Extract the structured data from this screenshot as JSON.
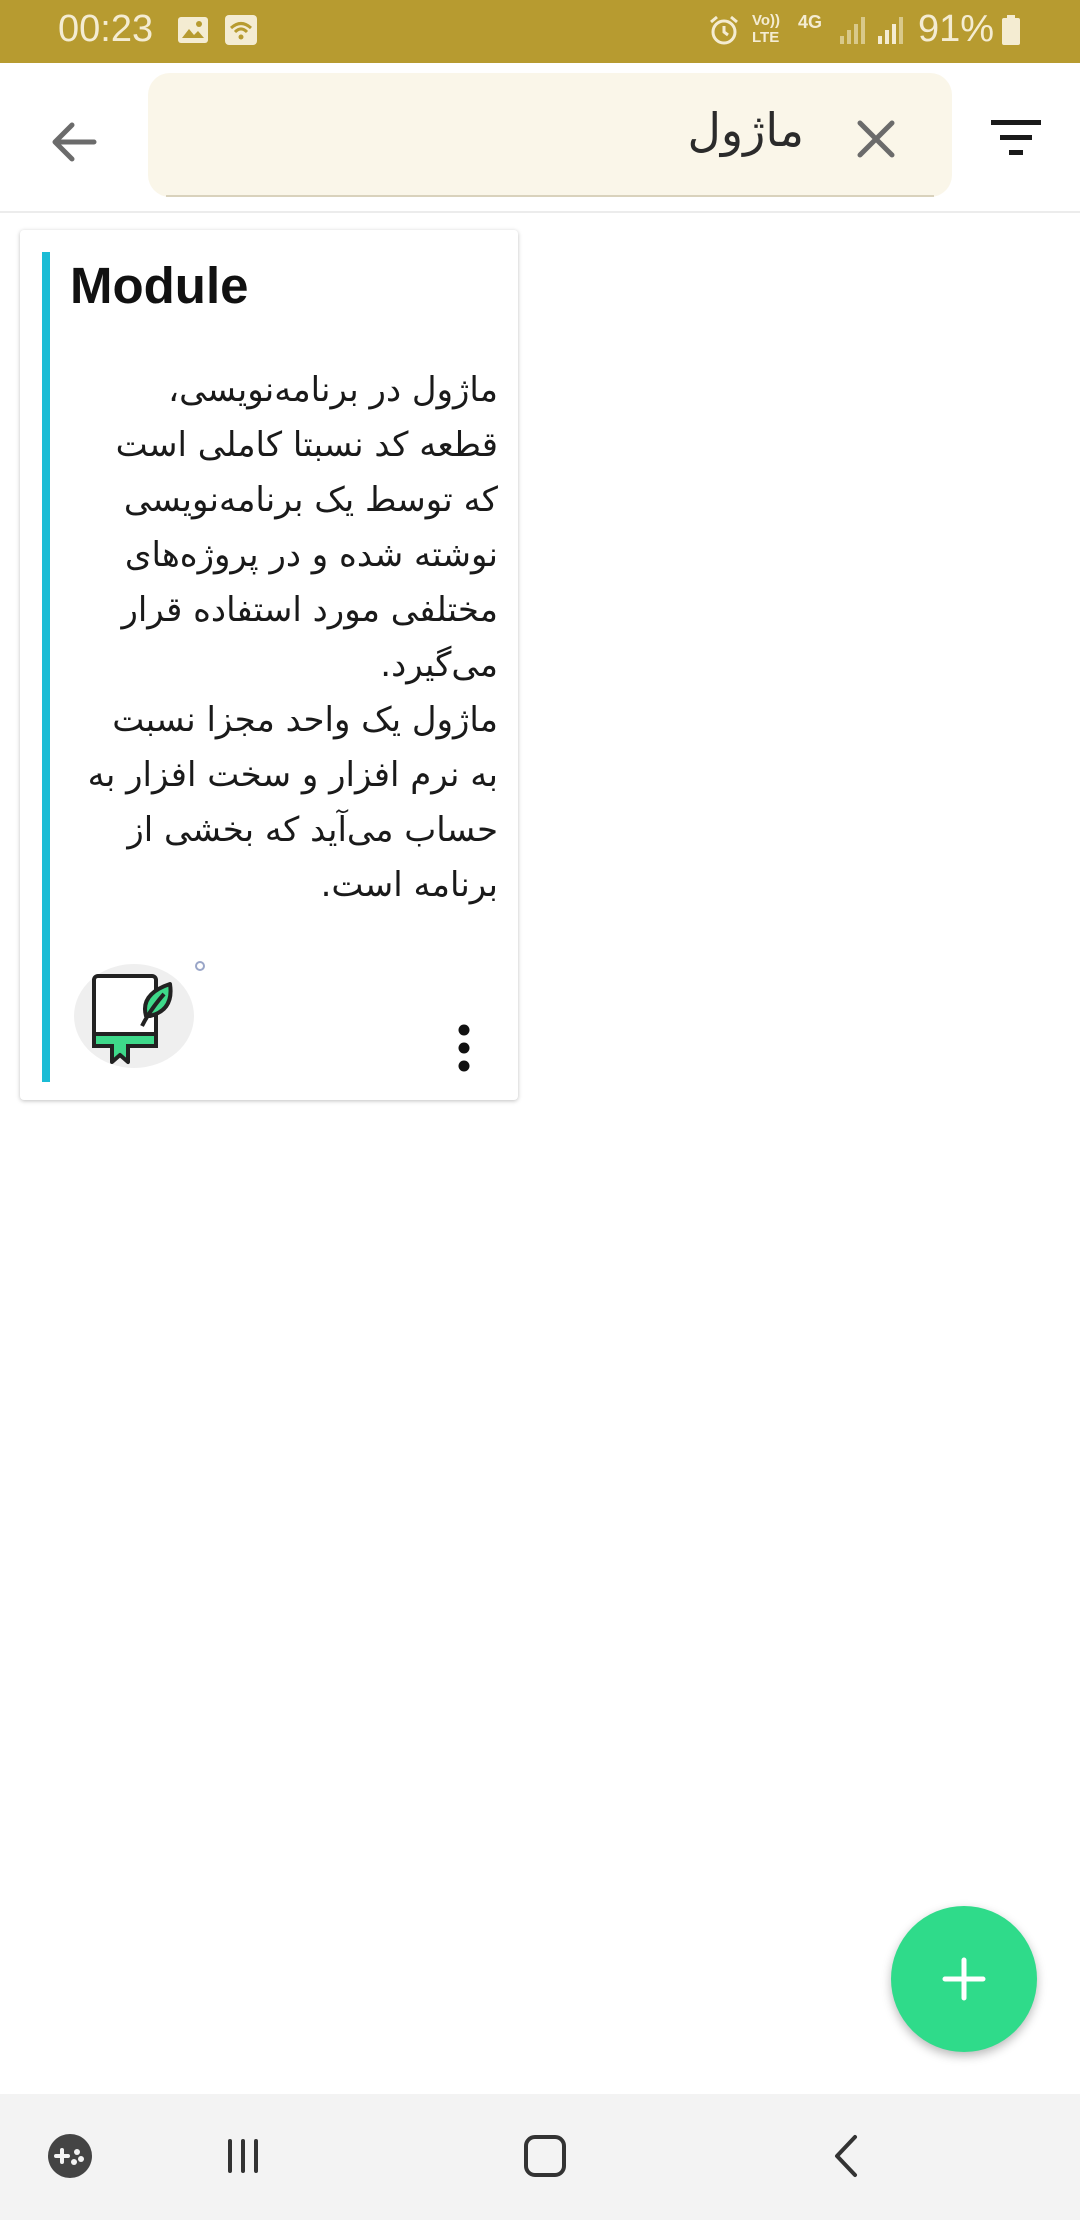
{
  "status_bar": {
    "time": "00:23",
    "battery_percent": "91%",
    "network": "4G",
    "volte_label": "Vo)) LTE",
    "bar_color": "#b79b30",
    "icons": [
      "gallery-icon",
      "wifi-icon",
      "alarm-icon",
      "volte-icon",
      "4g-icon",
      "signal-icon",
      "signal-icon",
      "battery-icon"
    ]
  },
  "toolbar": {
    "search_value": "ماژول",
    "back_icon": "arrow-left-icon",
    "clear_icon": "close-icon",
    "filter_icon": "filter-icon"
  },
  "card": {
    "title": "Module",
    "body": "ماژول در برنامه‌نویسی،\nقطعه کد نسبتا کاملی است\nکه توسط یک برنامه‌نویسی\nنوشته شده و در پروژه‌های\nمختلفی مورد استفاده قرار\nمی‌گیرد.\nماژول یک واحد مجزا نسبت\nبه نرم افزار و سخت افزار به\nحساب می‌آید که بخشی از\nبرنامه است.",
    "accent_color": "#1bbcd5",
    "icon": "book-leaf-icon",
    "menu_icon": "more-vertical-icon"
  },
  "fab": {
    "icon": "plus-icon",
    "color": "#2fdb8a"
  },
  "nav_bar": {
    "icons": [
      "game-launcher-icon",
      "recents-icon",
      "home-icon",
      "back-icon"
    ]
  }
}
